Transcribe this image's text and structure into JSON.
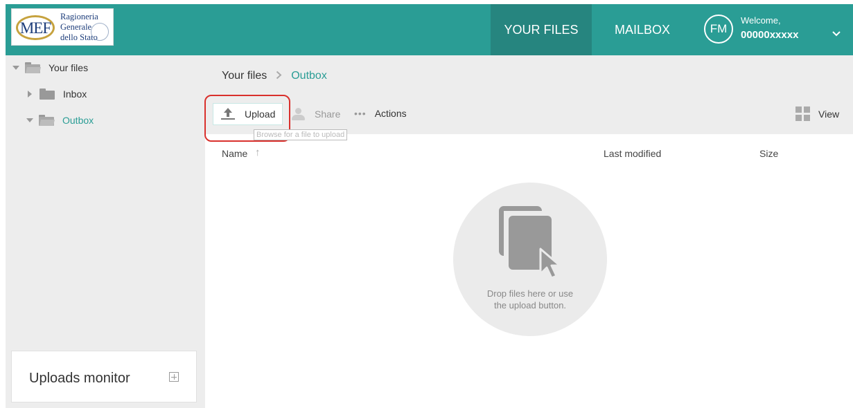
{
  "header": {
    "logo": {
      "mark": "MEF",
      "line1": "Ragioneria",
      "line2": "Generale",
      "line3": "dello Stato"
    },
    "nav": {
      "your_files": "YOUR FILES",
      "mailbox": "MAILBOX"
    },
    "user": {
      "initials": "FM",
      "welcome": "Welcome,",
      "id": "00000xxxxx"
    }
  },
  "sidebar": {
    "tree": [
      {
        "label": "Your files",
        "expanded": true,
        "active": false
      },
      {
        "label": "Inbox",
        "expanded": false,
        "active": false
      },
      {
        "label": "Outbox",
        "expanded": true,
        "active": true
      }
    ],
    "uploads_monitor": "Uploads monitor"
  },
  "breadcrumb": {
    "root": "Your files",
    "separator": ">",
    "current": "Outbox"
  },
  "toolbar": {
    "upload": "Upload",
    "upload_tooltip": "Browse for a file to upload",
    "share": "Share",
    "actions_dots": "•••",
    "actions": "Actions",
    "view": "View"
  },
  "table": {
    "columns": {
      "name": "Name",
      "sort_arrow": "↑",
      "last_modified": "Last modified",
      "size": "Size"
    }
  },
  "empty_state": {
    "line1": "Drop files here or use",
    "line2": "the upload button."
  },
  "colors": {
    "header_bg": "#2a9d95",
    "active_nav_bg": "#26857f",
    "accent": "#2a9d95",
    "highlight": "#d9302c"
  }
}
